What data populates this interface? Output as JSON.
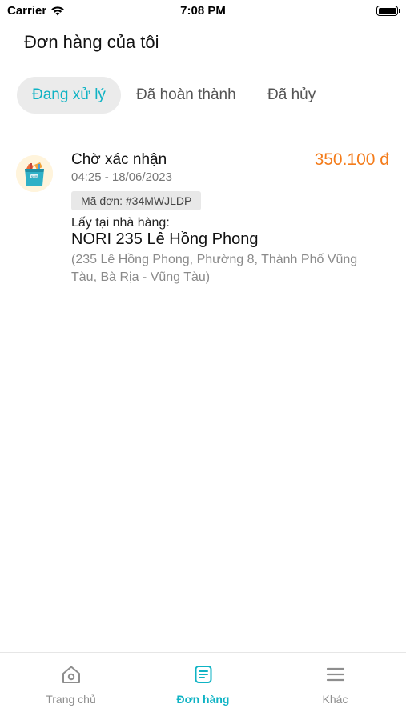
{
  "status_bar": {
    "carrier": "Carrier",
    "time": "7:08 PM"
  },
  "header": {
    "title": "Đơn hàng của tôi"
  },
  "tabs": [
    {
      "label": "Đang xử lý",
      "active": true
    },
    {
      "label": "Đã hoàn thành",
      "active": false
    },
    {
      "label": "Đã hủy",
      "active": false
    }
  ],
  "orders": [
    {
      "status": "Chờ xác nhận",
      "time": "04:25 - 18/06/2023",
      "price": "350.100 đ",
      "code": "Mã đơn: #34MWJLDP",
      "pickup_label": "Lấy tại nhà hàng:",
      "store_name": "NORI 235 Lê Hồng Phong",
      "store_address": "(235 Lê Hồng Phong, Phường 8, Thành Phố Vũng Tàu, Bà Rịa - Vũng Tàu)",
      "logo_icon": "store-bag-logo"
    }
  ],
  "bottom_nav": [
    {
      "label": "Trang chủ",
      "icon": "home-icon",
      "active": false
    },
    {
      "label": "Đơn hàng",
      "icon": "order-list-icon",
      "active": true
    },
    {
      "label": "Khác",
      "icon": "menu-icon",
      "active": false
    }
  ],
  "colors": {
    "accent": "#0fb3c4",
    "price": "#f47c1b",
    "inactive": "#8e8e8e"
  }
}
